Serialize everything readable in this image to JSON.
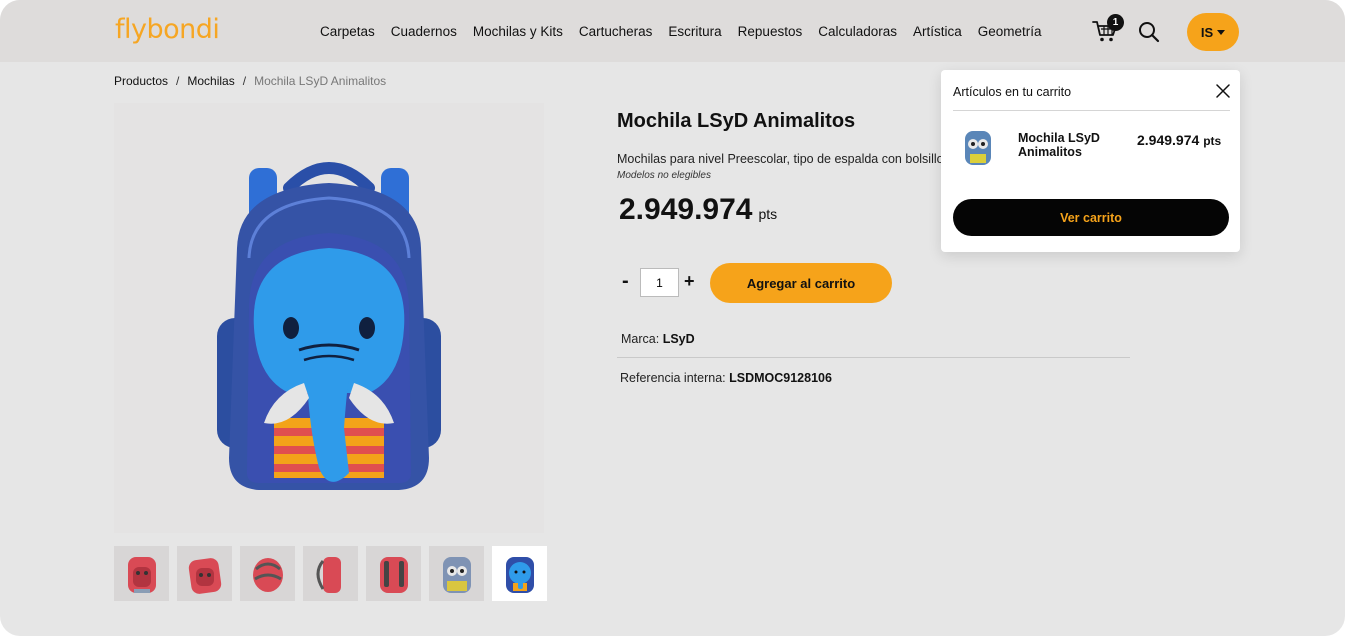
{
  "header": {
    "logo": "flybondi",
    "nav": [
      "Carpetas",
      "Cuadernos",
      "Mochilas y Kits",
      "Cartucheras",
      "Escritura",
      "Repuestos",
      "Calculadoras",
      "Artística",
      "Geometría"
    ],
    "cart_count": "1",
    "user_initials": "IS"
  },
  "breadcrumb": {
    "items": [
      "Productos",
      "Mochilas"
    ],
    "separator": "/",
    "current": "Mochila LSyD Animalitos"
  },
  "product": {
    "title": "Mochila LSyD Animalitos",
    "description": "Mochilas para nivel Preescolar, tipo de espalda con bolsillo",
    "note": "Modelos no elegibles",
    "price": "2.949.974",
    "price_unit": "pts",
    "quantity": "1",
    "minus_label": "-",
    "plus_label": "+",
    "add_to_cart": "Agregar al carrito",
    "brand_label": "Marca:",
    "brand": "LSyD",
    "ref_label": "Referencia interna:",
    "ref": "LSDMOC9128106",
    "thumbnails": [
      "red-backpack-front",
      "red-backpack-angle",
      "red-backpack-top",
      "red-backpack-side",
      "red-backpack-back",
      "blue-owl-backpack",
      "blue-elephant-backpack"
    ]
  },
  "cart_popup": {
    "title": "Artículos en tu carrito",
    "item_name": "Mochila LSyD Animalitos",
    "item_price": "2.949.974",
    "item_unit": "pts",
    "button": "Ver carrito"
  },
  "colors": {
    "accent": "#f6a31a",
    "header_bg": "#dedcdb",
    "page_bg": "#e6e6e6"
  }
}
